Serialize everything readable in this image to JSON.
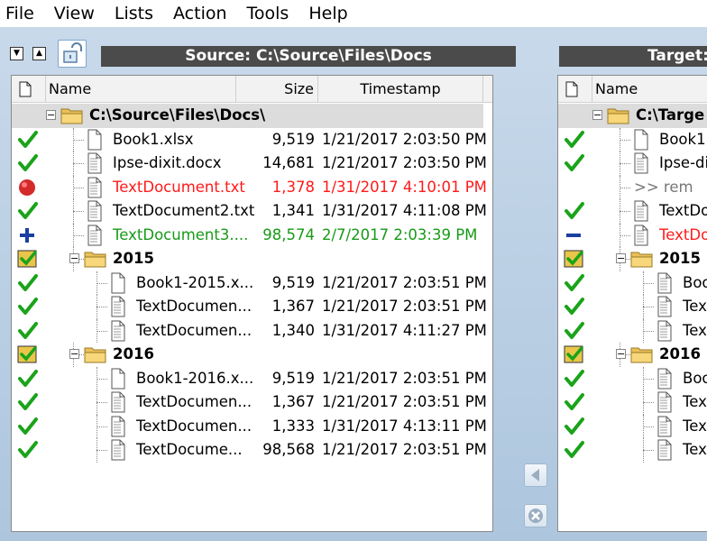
{
  "menu": [
    "File",
    "View",
    "Lists",
    "Action",
    "Tools",
    "Help"
  ],
  "source": {
    "title": "Source: C:\\Source\\Files\\Docs",
    "columns": {
      "name": "Name",
      "size": "Size",
      "timestamp": "Timestamp"
    },
    "rows": [
      {
        "status": "",
        "level": 0,
        "type": "root",
        "name": "C:\\Source\\Files\\Docs\\",
        "size": "",
        "ts": "",
        "color": ""
      },
      {
        "status": "check",
        "level": 1,
        "type": "file",
        "name": "Book1.xlsx",
        "size": "9,519",
        "ts": "1/21/2017 2:03:50 PM",
        "color": ""
      },
      {
        "status": "check",
        "level": 1,
        "type": "file",
        "name": "Ipse-dixit.docx",
        "size": "14,681",
        "ts": "1/21/2017 2:03:50 PM",
        "color": ""
      },
      {
        "status": "dot",
        "level": 1,
        "type": "file",
        "name": "TextDocument.txt",
        "size": "1,378",
        "ts": "1/31/2017 4:10:01 PM",
        "color": "red"
      },
      {
        "status": "check",
        "level": 1,
        "type": "file",
        "name": "TextDocument2.txt",
        "size": "1,341",
        "ts": "1/31/2017 4:11:08 PM",
        "color": ""
      },
      {
        "status": "plus",
        "level": 1,
        "type": "file",
        "name": "TextDocument3....",
        "size": "98,574",
        "ts": "2/7/2017 2:03:39 PM",
        "color": "green"
      },
      {
        "status": "box",
        "level": 1,
        "type": "folder",
        "name": "2015",
        "size": "",
        "ts": "",
        "color": ""
      },
      {
        "status": "check",
        "level": 2,
        "type": "file",
        "name": "Book1-2015.x...",
        "size": "9,519",
        "ts": "1/21/2017 2:03:51 PM",
        "color": ""
      },
      {
        "status": "check",
        "level": 2,
        "type": "file",
        "name": "TextDocumen...",
        "size": "1,367",
        "ts": "1/21/2017 2:03:51 PM",
        "color": ""
      },
      {
        "status": "check",
        "level": 2,
        "type": "file",
        "name": "TextDocumen...",
        "size": "1,340",
        "ts": "1/31/2017 4:11:27 PM",
        "color": ""
      },
      {
        "status": "box",
        "level": 1,
        "type": "folder",
        "name": "2016",
        "size": "",
        "ts": "",
        "color": ""
      },
      {
        "status": "check",
        "level": 2,
        "type": "file",
        "name": "Book1-2016.x...",
        "size": "9,519",
        "ts": "1/21/2017 2:03:51 PM",
        "color": ""
      },
      {
        "status": "check",
        "level": 2,
        "type": "file",
        "name": "TextDocumen...",
        "size": "1,367",
        "ts": "1/21/2017 2:03:51 PM",
        "color": ""
      },
      {
        "status": "check",
        "level": 2,
        "type": "file",
        "name": "TextDocumen...",
        "size": "1,333",
        "ts": "1/31/2017 4:13:11 PM",
        "color": ""
      },
      {
        "status": "check",
        "level": 2,
        "type": "file",
        "name": "TextDocume...",
        "size": "98,568",
        "ts": "1/21/2017 2:03:51 PM",
        "color": ""
      }
    ]
  },
  "target": {
    "title": "Target:",
    "columns": {
      "name": "Name"
    },
    "rows": [
      {
        "status": "",
        "level": 0,
        "type": "root",
        "name": "C:\\Targe",
        "color": ""
      },
      {
        "status": "check",
        "level": 1,
        "type": "file",
        "name": "Book1.",
        "color": ""
      },
      {
        "status": "check",
        "level": 1,
        "type": "file",
        "name": "Ipse-di",
        "color": ""
      },
      {
        "status": "",
        "level": 1,
        "type": "placeholder",
        "name": ">> rem",
        "color": "gray"
      },
      {
        "status": "check",
        "level": 1,
        "type": "file",
        "name": "TextDo",
        "color": ""
      },
      {
        "status": "minus",
        "level": 1,
        "type": "file",
        "name": "TextDo",
        "color": "red"
      },
      {
        "status": "box",
        "level": 1,
        "type": "folder",
        "name": "2015",
        "color": ""
      },
      {
        "status": "check",
        "level": 2,
        "type": "file",
        "name": "Boo",
        "color": ""
      },
      {
        "status": "check",
        "level": 2,
        "type": "file",
        "name": "Tex",
        "color": ""
      },
      {
        "status": "check",
        "level": 2,
        "type": "file",
        "name": "Tex",
        "color": ""
      },
      {
        "status": "box",
        "level": 1,
        "type": "folder",
        "name": "2016",
        "color": ""
      },
      {
        "status": "check",
        "level": 2,
        "type": "file",
        "name": "Boo",
        "color": ""
      },
      {
        "status": "check",
        "level": 2,
        "type": "file",
        "name": "Tex",
        "color": ""
      },
      {
        "status": "check",
        "level": 2,
        "type": "file",
        "name": "Tex",
        "color": ""
      },
      {
        "status": "check",
        "level": 2,
        "type": "file",
        "name": "Tex",
        "color": ""
      }
    ]
  },
  "icons": {
    "status": {
      "check": "check-icon",
      "dot": "red-dot-icon",
      "plus": "plus-icon",
      "minus": "minus-icon",
      "box": "folder-check-icon"
    },
    "toolbar": [
      "move-down-icon",
      "move-up-icon",
      "lock-icon"
    ],
    "middle": [
      "copy-left-icon",
      "cancel-icon"
    ]
  },
  "colors": {
    "check": "#1aa31a",
    "red": "#ff1a1a",
    "green": "#179a17",
    "plus": "#1a3fa0",
    "panebar": "#4b4b4b"
  }
}
